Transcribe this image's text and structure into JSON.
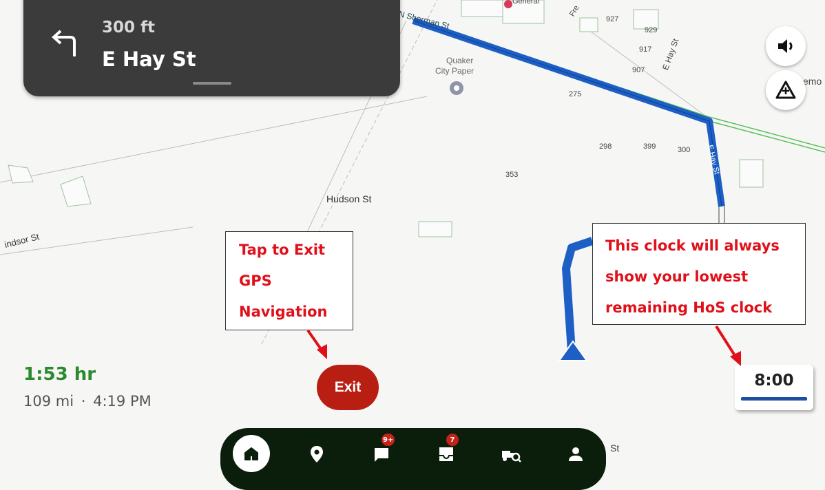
{
  "navigation": {
    "distance": "300 ft",
    "street": "E Hay St",
    "turn_icon": "turn-left-arrow"
  },
  "map_labels": {
    "sherman": "N Sherman St",
    "general": "General",
    "fre": "Fre",
    "n927": "927",
    "n929": "929",
    "n917": "917",
    "n907": "907",
    "ehay_top": "E Hay St",
    "quaker1": "Quaker",
    "quaker2": "City Paper",
    "n275": "275",
    "emo": "emo",
    "n298": "298",
    "n399": "399",
    "n300": "300",
    "ehay_route": "E Hay St",
    "n353": "353",
    "hudson": "Hudson St",
    "windsor": "indsor St",
    "st": "St"
  },
  "trip": {
    "eta_duration": "1:53 hr",
    "distance": "109 mi",
    "separator": "·",
    "arrival": "4:19 PM"
  },
  "exit_button": {
    "label": "Exit"
  },
  "hos_clock": {
    "time": "8:00"
  },
  "callouts": {
    "exit_lines": [
      "Tap to Exit",
      "GPS",
      "Navigation"
    ],
    "clock_lines": [
      "This clock will always",
      "show your lowest",
      "remaining HoS clock"
    ]
  },
  "side_buttons": {
    "volume_icon": "volume-icon",
    "report_icon": "report-hazard-icon"
  },
  "bottom_nav": {
    "items": [
      {
        "name": "home",
        "icon": "home-icon"
      },
      {
        "name": "location",
        "icon": "location-pin-icon"
      },
      {
        "name": "messages",
        "icon": "chat-icon",
        "badge": "9+"
      },
      {
        "name": "inbox",
        "icon": "inbox-icon",
        "badge": "7"
      },
      {
        "name": "vehicle-inspection",
        "icon": "truck-search-icon"
      },
      {
        "name": "profile",
        "icon": "person-icon"
      }
    ]
  },
  "colors": {
    "route": "#1d5fc4",
    "eta_green": "#2a8a30",
    "exit_red": "#b81f12",
    "callout_text": "#e0101a",
    "nav_bg": "#3b3b3b",
    "bottom_bar": "#0b1d0b"
  }
}
